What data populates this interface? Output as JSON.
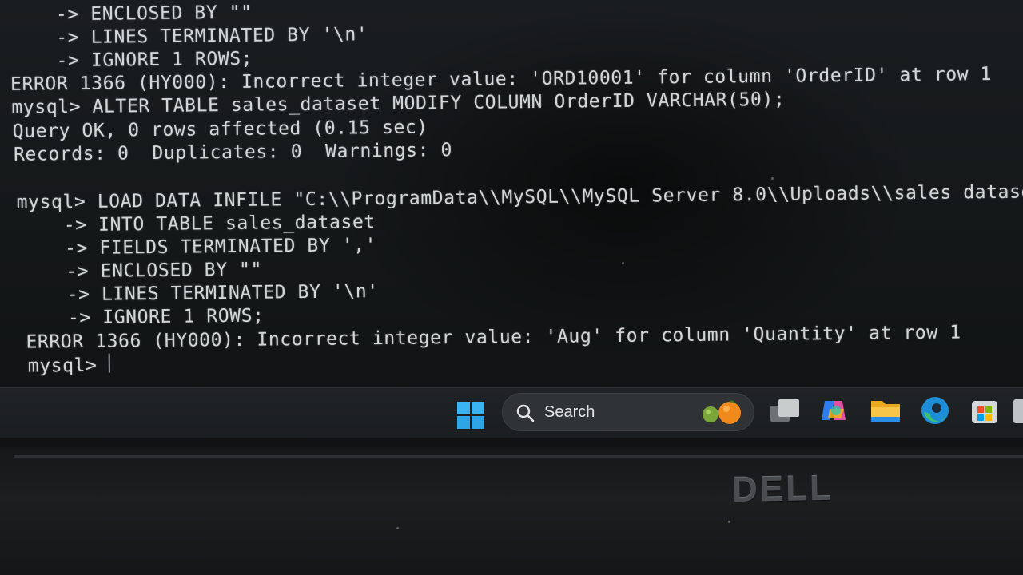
{
  "terminal": {
    "lines": [
      "    -> ENCLOSED BY \"\"",
      "    -> LINES TERMINATED BY '\\n'",
      "    -> IGNORE 1 ROWS;",
      "ERROR 1366 (HY000): Incorrect integer value: 'ORD10001' for column 'OrderID' at row 1",
      "mysql> ALTER TABLE sales_dataset MODIFY COLUMN OrderID VARCHAR(50);",
      "Query OK, 0 rows affected (0.15 sec)",
      "Records: 0  Duplicates: 0  Warnings: 0",
      "mysql> LOAD DATA INFILE \"C:\\\\ProgramData\\\\MySQL\\\\MySQL Server 8.0\\\\Uploads\\\\sales dataset.",
      "    -> INTO TABLE sales_dataset",
      "    -> FIELDS TERMINATED BY ','",
      "    -> ENCLOSED BY \"\"",
      "    -> LINES TERMINATED BY '\\n'",
      "    -> IGNORE 1 ROWS;",
      "ERROR 1366 (HY000): Incorrect integer value: 'Aug' for column 'Quantity' at row 1",
      "mysql> "
    ]
  },
  "taskbar": {
    "search_label": "Search",
    "icons": [
      "windows-start-icon",
      "search-icon",
      "task-view-icon",
      "copilot-icon",
      "file-explorer-icon",
      "edge-browser-icon",
      "microsoft-store-icon"
    ]
  },
  "bezel": {
    "brand": "DELL"
  }
}
